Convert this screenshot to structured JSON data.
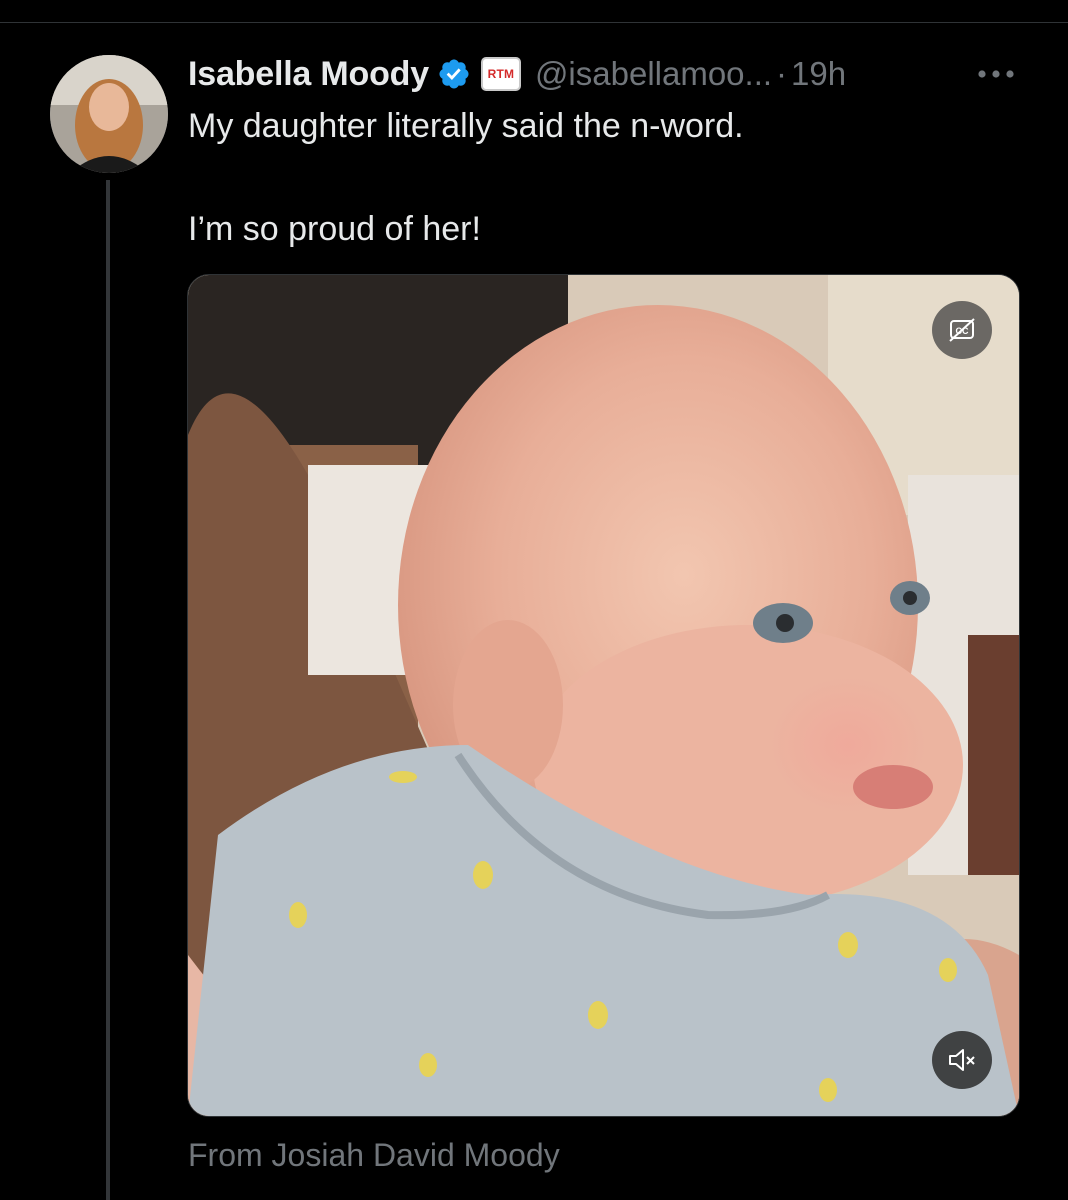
{
  "author": {
    "display_name": "Isabella Moody",
    "verified_icon": "verified-badge-icon",
    "affiliation_badge": "RTM",
    "handle": "@isabellamoo...",
    "separator": "·",
    "time": "19h",
    "avatar_icon": "profile-avatar"
  },
  "menu": {
    "more_icon": "more-options-icon",
    "more_label": "•••"
  },
  "tweet": {
    "line1": "My daughter literally said the n-word.",
    "line2": "I’m so proud of her!"
  },
  "media": {
    "type": "video",
    "captions_icon": "captions-off-icon",
    "mute_icon": "muted-speaker-icon",
    "source_label": "From Josiah David Moody"
  },
  "colors": {
    "background": "#000000",
    "primary_text": "#e7e9ea",
    "secondary_text": "#71767b",
    "verified_blue": "#1d9bf0",
    "divider": "#2f3336"
  }
}
